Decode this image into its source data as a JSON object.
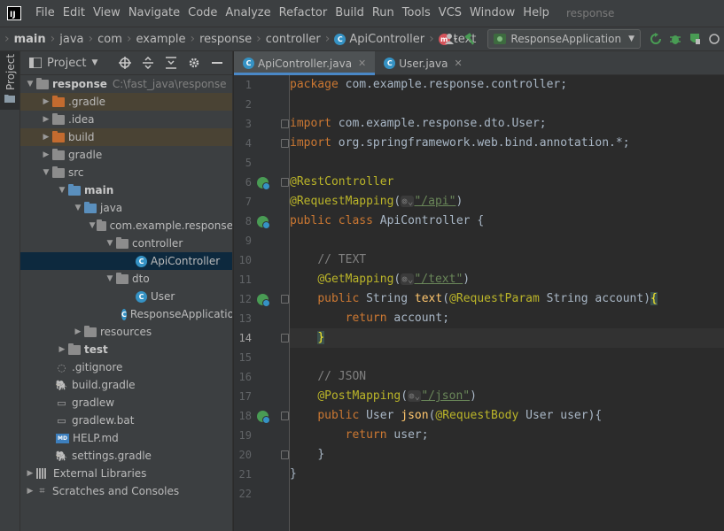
{
  "menubar": {
    "logo_text": "IJ",
    "items": [
      "File",
      "Edit",
      "View",
      "Navigate",
      "Code",
      "Analyze",
      "Refactor",
      "Build",
      "Run",
      "Tools",
      "VCS",
      "Window",
      "Help"
    ],
    "project_title": "response"
  },
  "navbar": {
    "crumbs": [
      "main",
      "java",
      "com",
      "example",
      "response",
      "controller"
    ],
    "class_crumb": "ApiController",
    "method_crumb": "text",
    "run_config": "ResponseApplication"
  },
  "left_strip": {
    "label": "Project"
  },
  "project_panel": {
    "title": "Project",
    "tree": [
      {
        "label": "response",
        "note": "C:\\fast_java\\response"
      },
      {
        "label": ".gradle"
      },
      {
        "label": ".idea"
      },
      {
        "label": "build"
      },
      {
        "label": "gradle"
      },
      {
        "label": "src"
      },
      {
        "label": "main"
      },
      {
        "label": "java"
      },
      {
        "label": "com.example.response"
      },
      {
        "label": "controller"
      },
      {
        "label": "ApiController"
      },
      {
        "label": "dto"
      },
      {
        "label": "User"
      },
      {
        "label": "ResponseApplication"
      },
      {
        "label": "resources"
      },
      {
        "label": "test"
      },
      {
        "label": ".gitignore"
      },
      {
        "label": "build.gradle"
      },
      {
        "label": "gradlew"
      },
      {
        "label": "gradlew.bat"
      },
      {
        "label": "HELP.md"
      },
      {
        "label": "settings.gradle"
      },
      {
        "label": "External Libraries"
      },
      {
        "label": "Scratches and Consoles"
      }
    ]
  },
  "tabs": [
    {
      "label": "ApiController.java",
      "active": true
    },
    {
      "label": "User.java",
      "active": false
    }
  ],
  "editor": {
    "line_numbers": [
      "1",
      "2",
      "3",
      "4",
      "5",
      "6",
      "7",
      "8",
      "9",
      "10",
      "11",
      "12",
      "13",
      "14",
      "15",
      "16",
      "17",
      "18",
      "19",
      "20",
      "21",
      "22"
    ],
    "current_line": "14",
    "tokens": {
      "package_kw": "package",
      "package_name": " com.example.response.controller;",
      "import_kw": "import",
      "import1": " com.example.response.dto.User;",
      "import2": " org.springframework.web.bind.annotation.*;",
      "rest_controller": "@RestController",
      "request_mapping": "@RequestMapping",
      "api_path": "\"/api\"",
      "public_kw": "public",
      "class_kw": "class",
      "class_name": " ApiController {",
      "comment_text": "// TEXT",
      "get_mapping": "@GetMapping",
      "text_path": "\"/text\"",
      "string_type": " String ",
      "text_fn": "text",
      "request_param": "@RequestParam",
      "param_text": " String account)",
      "brace_open": "{",
      "return_kw": "return",
      "return_account": " account;",
      "brace_close": "}",
      "comment_json": "// JSON",
      "post_mapping": "@PostMapping",
      "json_path": "\"/json\"",
      "user_type": " User ",
      "json_fn": "json",
      "request_body": "@RequestBody",
      "param_json": " User user){",
      "return_user": " user;",
      "close_method": "}",
      "close_class": "}",
      "paren_open": "(",
      "paren_close": ")",
      "hint_icon": "⊚⌄"
    }
  }
}
